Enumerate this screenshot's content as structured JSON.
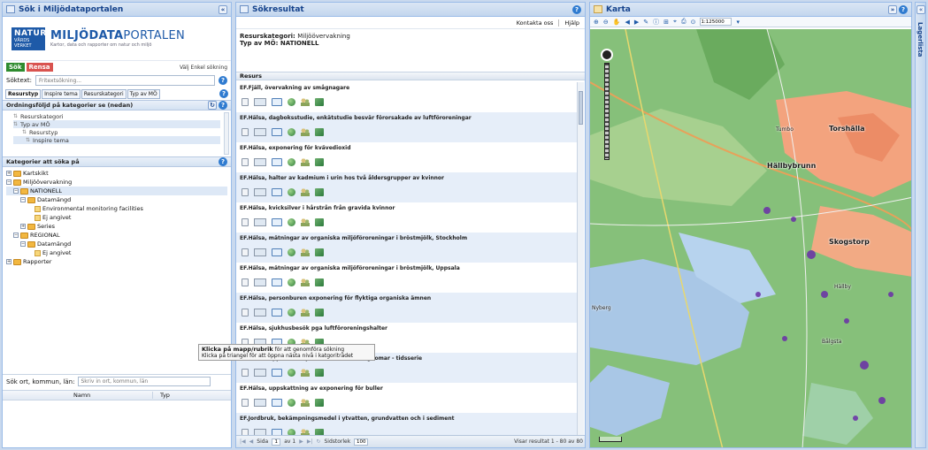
{
  "left": {
    "title": "Sök i Miljödataportalen",
    "collapse_label": "«",
    "logo": {
      "natur": "NATUR",
      "natur_sub": "VÅRDS VERKET",
      "brand_bold": "MILJÖDATA",
      "brand_rest": "PORTALEN",
      "tagline": "Kartor, data och rapporter om natur och miljö"
    },
    "sok_label": "Sök",
    "rensa_label": "Rensa",
    "enkel_link": "Välj Enkel sökning",
    "soktext_label": "Söktext:",
    "soktext_placeholder": "Fritextsökning...",
    "tabs": [
      "Resurstyp",
      "Inspire tema",
      "Resurskategori",
      "Typ av MÖ"
    ],
    "order_header": "Ordningsföljd på kategorier se (nedan)",
    "order_items": [
      "Resurskategori",
      "Typ av MÖ",
      "Resurstyp",
      "Inspire tema"
    ],
    "cat_header": "Kategorier att söka på",
    "tree": [
      "Kartskikt",
      "Miljöövervakning",
      "NATIONELL",
      "Datamängd",
      "Environmental monitoring facilities",
      "Ej angivet",
      "Series",
      "REGIONAL",
      "Datamängd",
      "Ej angivet",
      "Rapporter"
    ],
    "ort_label": "Sök ort, kommun, län:",
    "ort_placeholder": "Skriv in ort, kommun, län",
    "col_namn": "Namn",
    "col_typ": "Typ"
  },
  "mid": {
    "title": "Sökresultat",
    "kontakta": "Kontakta oss",
    "hjalp": "Hjälp",
    "crit1_label": "Resurskategori:",
    "crit1_value": "Miljöövervakning",
    "crit2_label": "Typ av MÖ:",
    "crit2_value": "NATIONELL",
    "res_header": "Resurs",
    "results": [
      "EF.Fjäll, övervakning av smågnagare",
      "EF.Hälsa, dagboksstudie, enkätstudie besvär förorsakade av luftföroreningar",
      "EF.Hälsa, exponering för kvävedioxid",
      "EF.Hälsa, halter av kadmium i urin hos två åldersgrupper av kvinnor",
      "EF.Hälsa, kvicksilver i hårstrån från gravida kvinnor",
      "EF.Hälsa, mätningar av organiska miljöföroreningar i bröstmjölk, Stockholm",
      "EF.Hälsa, mätningar av organiska miljöföroreningar i bröstmjölk, Uppsala",
      "EF.Hälsa, personburen exponering för flyktiga organiska ämnen",
      "EF.Hälsa, sjukhusbesök pga luftföroreningshalter",
      "EF.Hälsa, uppmätta blyhalter i blod hos ungdomar - tidsserie",
      "EF.Hälsa, uppskattning av exponering för buller",
      "EF.Jordbruk, bekämpningsmedel i ytvatten, grundvatten och i sediment"
    ],
    "pager": {
      "sida": "Sida",
      "page": "1",
      "av": "av 1",
      "sidstorlek": "Sidstorlek",
      "size": "100",
      "info": "Visar resultat 1 - 80 av 80"
    }
  },
  "tooltip": {
    "bold": "Klicka på mapp/rubrik",
    "rest": "för att genomföra sökning",
    "line2": "Klicka på triangel för att öppna nästa nivå i katgoriträdet"
  },
  "map": {
    "title": "Karta",
    "scale": "1:125000",
    "labels": [
      "Torshälla",
      "Hällbybrunn",
      "Skogstorp",
      "Tumbo",
      "Hällby",
      "Nyberg",
      "Bålgsta"
    ]
  },
  "lager": {
    "label": "Lagerlista"
  },
  "colors": {
    "panel_border": "#99bbe8",
    "title_text": "#15428b",
    "accent_green": "#2e8b2e",
    "accent_red": "#d9534f"
  }
}
